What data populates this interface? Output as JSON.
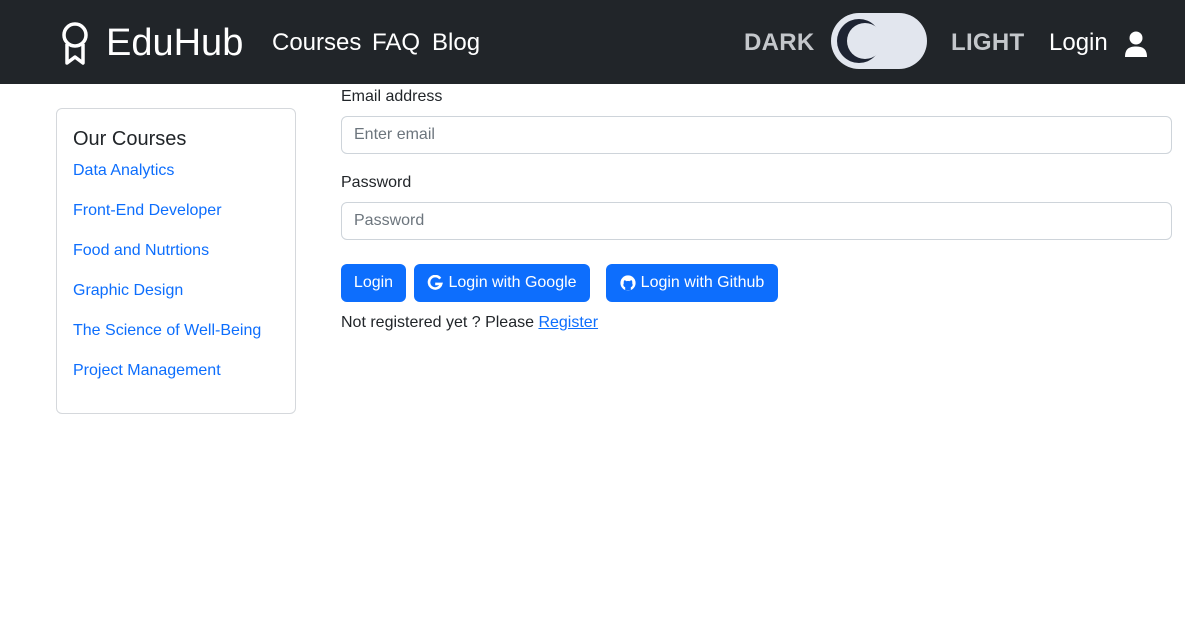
{
  "navbar": {
    "brand": "EduHub",
    "brand_icon": "award-icon",
    "links": [
      "Courses",
      "FAQ",
      "Blog"
    ],
    "dark_label": "DARK",
    "light_label": "LIGHT",
    "theme_toggle": {
      "state": "dark",
      "icon": "moon-icon"
    },
    "login_label": "Login",
    "user_icon": "person-icon",
    "background": "#212529"
  },
  "sidebar": {
    "title": "Our Courses",
    "courses": [
      "Data Analytics",
      "Front-End Developer",
      "Food and Nutrtions",
      "Graphic Design",
      "The Science of Well-Being",
      "Project Management"
    ]
  },
  "form": {
    "email_label": "Email address",
    "email_placeholder": "Enter email",
    "email_value": "",
    "password_label": "Password",
    "password_placeholder": "Password",
    "password_value": "",
    "login_button": "Login",
    "google_button": "Login with Google",
    "github_button": "Login with Github",
    "google_icon": "google-icon",
    "github_icon": "github-icon",
    "register_prompt": "Not registered yet ? Please",
    "register_link": "Register"
  },
  "colors": {
    "primary": "#0d6efd",
    "dark": "#212529",
    "toggle_track": "#e2e6ee"
  }
}
